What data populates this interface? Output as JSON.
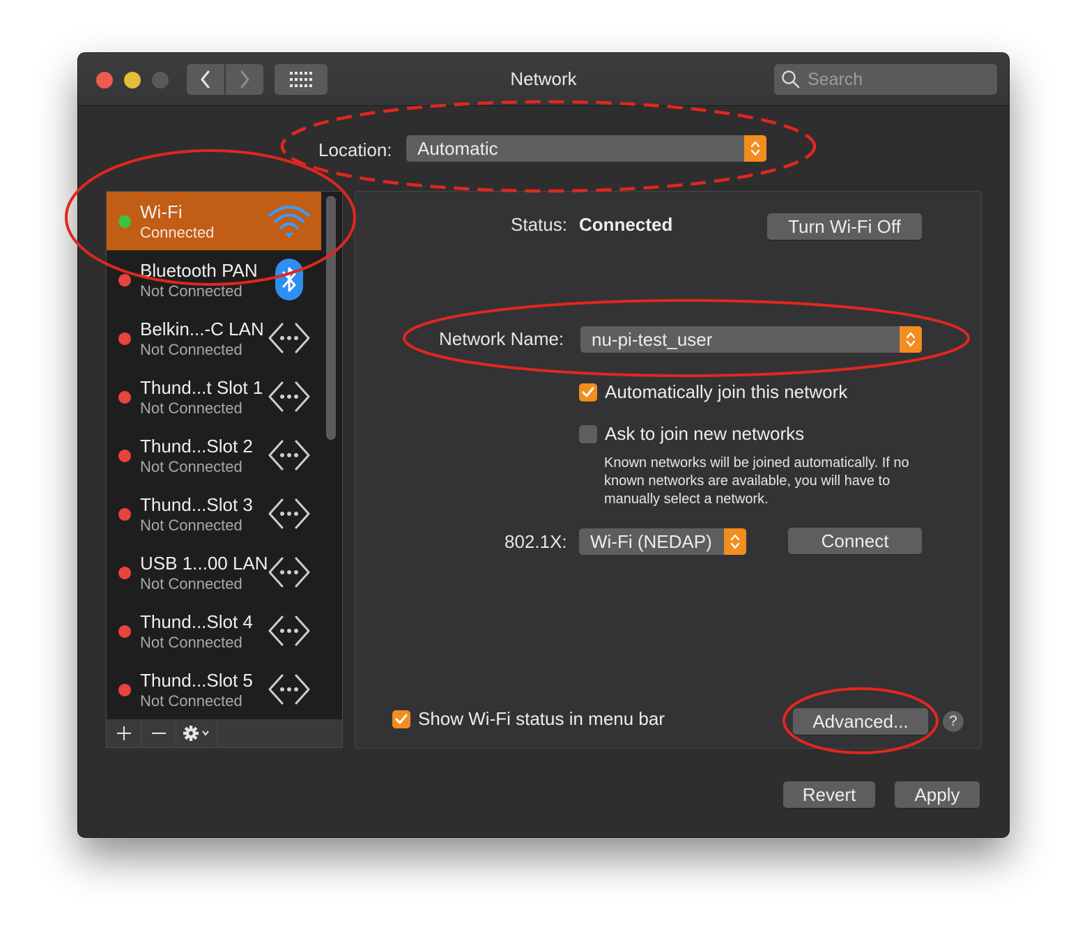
{
  "window": {
    "title": "Network",
    "search": {
      "placeholder": "Search"
    }
  },
  "location": {
    "label": "Location:",
    "value": "Automatic"
  },
  "services": [
    {
      "name": "Wi-Fi",
      "status": "Connected",
      "icon": "wifi-icon",
      "dot": "#3fc33f",
      "selected": true
    },
    {
      "name": "Bluetooth PAN",
      "status": "Not Connected",
      "icon": "bluetooth-icon",
      "dot": "#e8433e"
    },
    {
      "name": "Belkin...-C LAN",
      "status": "Not Connected",
      "icon": "ethernet-icon",
      "dot": "#e8433e"
    },
    {
      "name": "Thund...t Slot 1",
      "status": "Not Connected",
      "icon": "ethernet-icon",
      "dot": "#e8433e"
    },
    {
      "name": "Thund...Slot 2",
      "status": "Not Connected",
      "icon": "ethernet-icon",
      "dot": "#e8433e"
    },
    {
      "name": "Thund...Slot 3",
      "status": "Not Connected",
      "icon": "ethernet-icon",
      "dot": "#e8433e"
    },
    {
      "name": "USB 1...00 LAN",
      "status": "Not Connected",
      "icon": "ethernet-icon",
      "dot": "#e8433e"
    },
    {
      "name": "Thund...Slot 4",
      "status": "Not Connected",
      "icon": "ethernet-icon",
      "dot": "#e8433e"
    },
    {
      "name": "Thund...Slot 5",
      "status": "Not Connected",
      "icon": "ethernet-icon",
      "dot": "#e8433e"
    }
  ],
  "detail": {
    "status_label": "Status:",
    "status_value": "Connected",
    "turn_off_label": "Turn Wi-Fi Off",
    "network_name_label": "Network Name:",
    "network_name_value": "nu-pi-test_user",
    "auto_join_label": "Automatically join this network",
    "auto_join_checked": true,
    "ask_join_label": "Ask to join new networks",
    "ask_join_checked": false,
    "help_text": "Known networks will be joined automatically. If no known networks are available, you will have to manually select a network.",
    "x8021_label": "802.1X:",
    "x8021_value": "Wi-Fi (NEDAP)",
    "connect_label": "Connect",
    "show_status_label": "Show Wi-Fi status in menu bar",
    "show_status_checked": true,
    "advanced_label": "Advanced...",
    "help_glyph": "?"
  },
  "footer": {
    "revert_label": "Revert",
    "apply_label": "Apply"
  },
  "colors": {
    "accent": "#f28d1f",
    "selection": "#c25d16",
    "connected": "#3fc33f",
    "not_connected": "#e8433e",
    "annotation": "#e0271e"
  }
}
